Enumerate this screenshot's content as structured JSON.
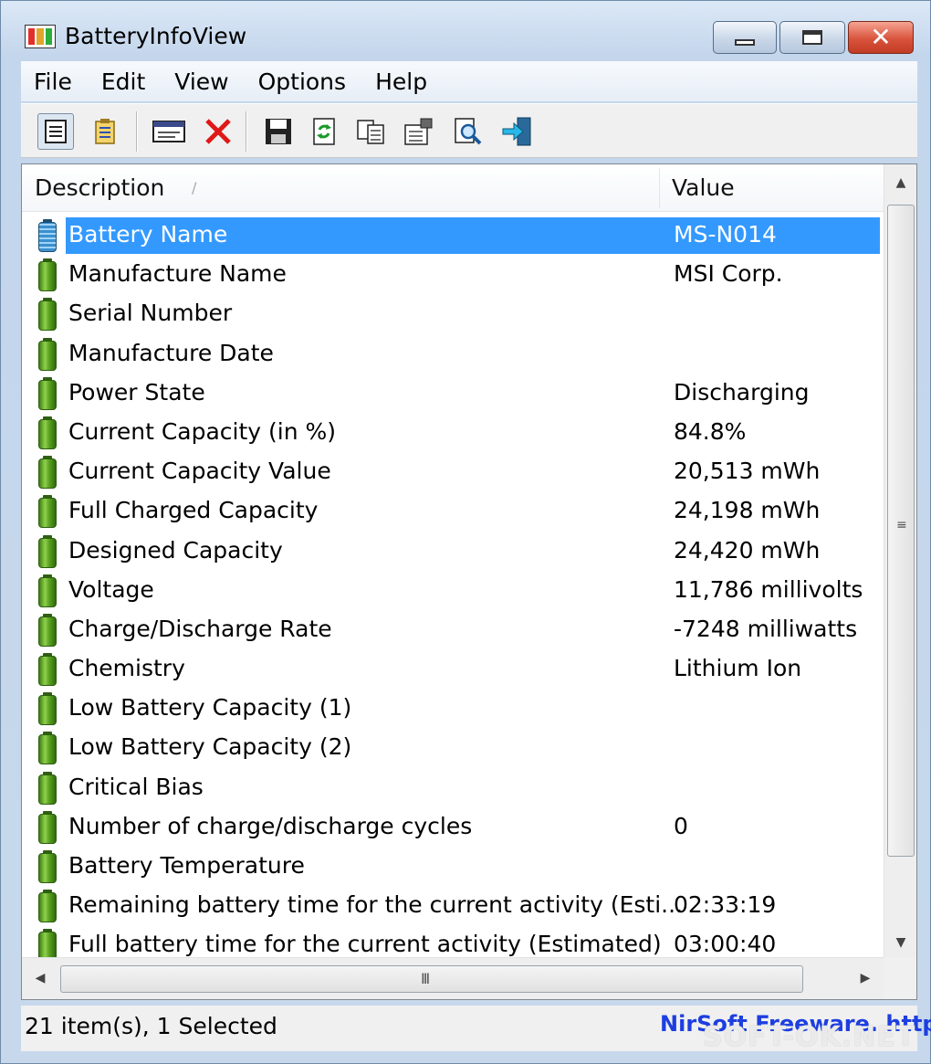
{
  "window": {
    "title": "BatteryInfoView",
    "close_symbol": "✕"
  },
  "menu": [
    "File",
    "Edit",
    "View",
    "Options",
    "Help"
  ],
  "toolbar": {
    "icons": [
      "view-details-icon",
      "properties-list-icon",
      "window-icon",
      "delete-icon",
      "save-icon",
      "refresh-icon",
      "copy-icon",
      "properties-icon",
      "find-icon",
      "exit-icon"
    ]
  },
  "columns": {
    "description": "Description",
    "value": "Value",
    "sort_indicator": "/"
  },
  "rows": [
    {
      "description": "Battery Name",
      "value": "MS-N014",
      "selected": true
    },
    {
      "description": "Manufacture Name",
      "value": "MSI Corp."
    },
    {
      "description": "Serial Number",
      "value": ""
    },
    {
      "description": "Manufacture Date",
      "value": ""
    },
    {
      "description": "Power State",
      "value": "Discharging"
    },
    {
      "description": "Current Capacity (in %)",
      "value": "84.8%"
    },
    {
      "description": "Current Capacity Value",
      "value": "20,513 mWh"
    },
    {
      "description": "Full Charged Capacity",
      "value": "24,198 mWh"
    },
    {
      "description": "Designed Capacity",
      "value": "24,420 mWh"
    },
    {
      "description": "Voltage",
      "value": "11,786 millivolts"
    },
    {
      "description": "Charge/Discharge Rate",
      "value": "-7248 milliwatts"
    },
    {
      "description": "Chemistry",
      "value": "Lithium Ion"
    },
    {
      "description": "Low Battery Capacity (1)",
      "value": ""
    },
    {
      "description": "Low Battery Capacity (2)",
      "value": ""
    },
    {
      "description": "Critical Bias",
      "value": ""
    },
    {
      "description": "Number of charge/discharge cycles",
      "value": "0"
    },
    {
      "description": "Battery Temperature",
      "value": ""
    },
    {
      "description": "Remaining battery time for the current activity (Esti...",
      "value": "02:33:19"
    },
    {
      "description": "Full battery time for the current activity (Estimated)",
      "value": "03:00:40"
    }
  ],
  "scrollbars": {
    "up_arrow": "▲",
    "down_arrow": "▼",
    "left_arrow": "◀",
    "right_arrow": "▶",
    "h_grip": "III",
    "v_grip": "≡"
  },
  "status": {
    "count": "21 item(s), 1 Selected",
    "link": "NirSoft Freeware.  http"
  },
  "watermark": "SOFT-OK.NET",
  "colors": {
    "selection": "#3399ff",
    "link": "#1d3ee0",
    "close_button": "#d9543d"
  }
}
